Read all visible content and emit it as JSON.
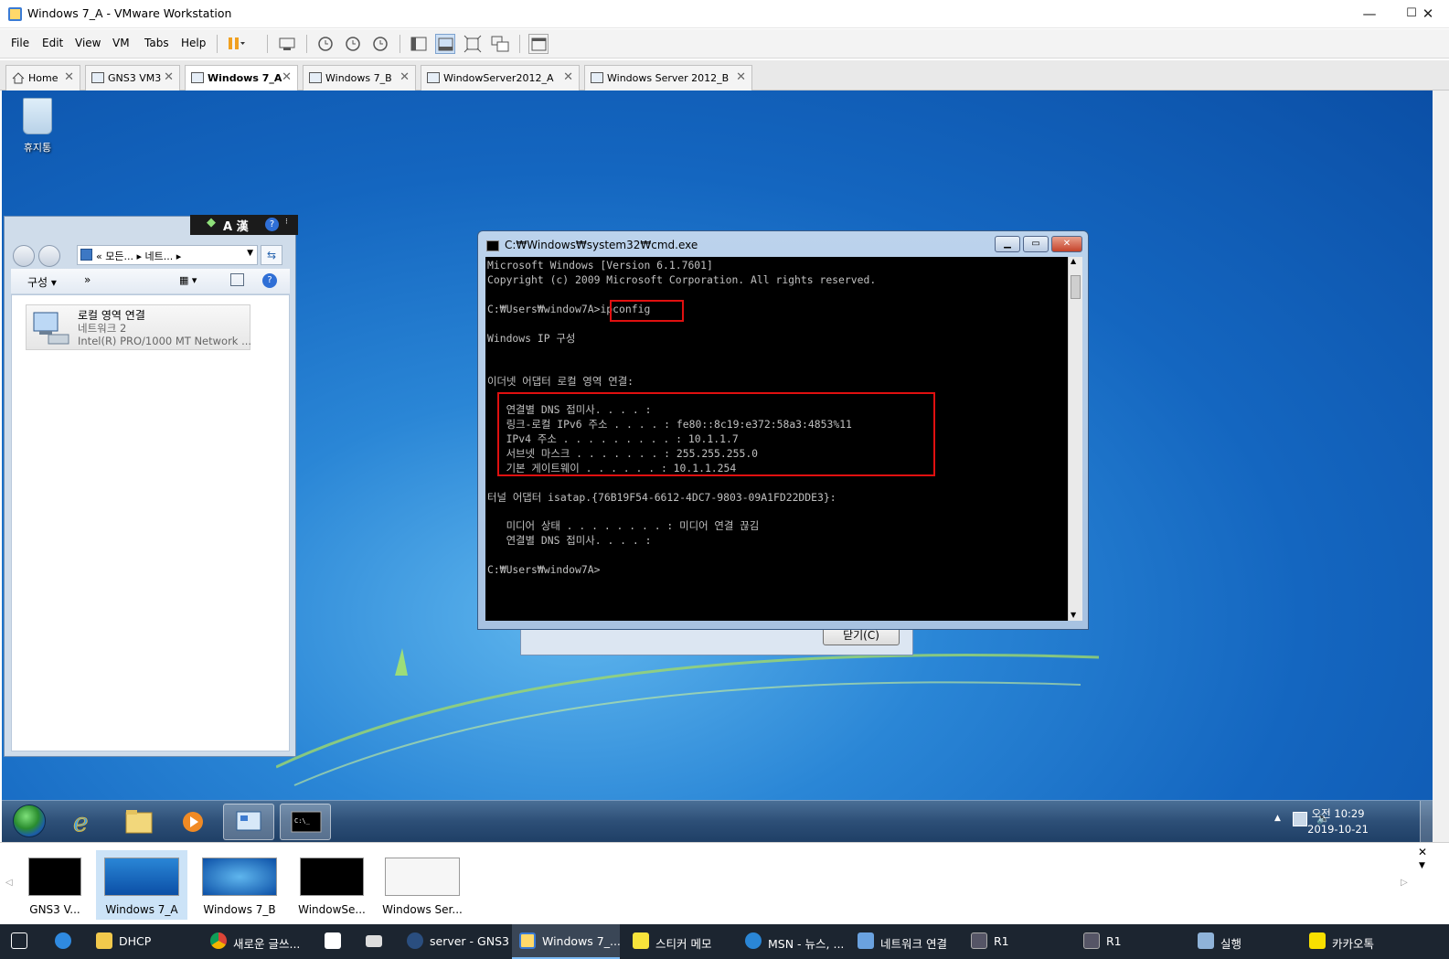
{
  "window": {
    "title": "Windows 7_A - VMware Workstation",
    "minimize": "—",
    "maximize": "☐",
    "close": "✕"
  },
  "menu": [
    "File",
    "Edit",
    "View",
    "VM",
    "Tabs",
    "Help"
  ],
  "tabs": [
    {
      "label": "Home"
    },
    {
      "label": "GNS3 VM3"
    },
    {
      "label": "Windows 7_A",
      "active": true
    },
    {
      "label": "Windows 7_B"
    },
    {
      "label": "WindowServer2012_A"
    },
    {
      "label": "Windows Server 2012_B"
    }
  ],
  "desktop": {
    "recycle_bin": "휴지통"
  },
  "explorer": {
    "ime": "A 漢",
    "address": "« 모든...  ▸ 네트...  ▸",
    "organize": "구성 ▾",
    "more": "»",
    "item": {
      "title": "로컬 영역 연결",
      "line2": "네트워크 2",
      "line3": "Intel(R) PRO/1000 MT Network ..."
    }
  },
  "dialog": {
    "close_button": "닫기(C)"
  },
  "cmd": {
    "title": "C:₩Windows₩system32₩cmd.exe",
    "lines": [
      "Microsoft Windows [Version 6.1.7601]",
      "Copyright (c) 2009 Microsoft Corporation. All rights reserved.",
      "",
      "C:₩Users₩window7A>ipconfig",
      "",
      "Windows IP 구성",
      "",
      "",
      "이더넷 어댑터 로컬 영역 연결:",
      "",
      "   연결별 DNS 접미사. . . . :",
      "   링크-로컬 IPv6 주소 . . . . : fe80::8c19:e372:58a3:4853%11",
      "   IPv4 주소 . . . . . . . . . : 10.1.1.7",
      "   서브넷 마스크 . . . . . . . : 255.255.255.0",
      "   기본 게이트웨이 . . . . . . : 10.1.1.254",
      "",
      "터널 어댑터 isatap.{76B19F54-6612-4DC7-9803-09A1FD22DDE3}:",
      "",
      "   미디어 상태 . . . . . . . . : 미디어 연결 끊김",
      "   연결별 DNS 접미사. . . . :",
      "",
      "C:₩Users₩window7A>"
    ]
  },
  "guest_clock": {
    "time": "오전 10:29",
    "date": "2019-10-21"
  },
  "thumbnails": [
    {
      "label": "GNS3 V..."
    },
    {
      "label": "Windows 7_A",
      "selected": true
    },
    {
      "label": "Windows 7_B"
    },
    {
      "label": "WindowSe..."
    },
    {
      "label": "Windows Ser..."
    }
  ],
  "host_taskbar": [
    {
      "label": "",
      "icon": "task-view-icon"
    },
    {
      "label": "",
      "icon": "edge-icon"
    },
    {
      "label": "DHCP",
      "icon": "folder-icon"
    },
    {
      "label": "새로운 글쓰...",
      "icon": "chrome-icon"
    },
    {
      "label": "",
      "icon": "store-icon"
    },
    {
      "label": "",
      "icon": "mail-icon"
    },
    {
      "label": "server - GNS3",
      "icon": "gns3-icon"
    },
    {
      "label": "Windows 7_...",
      "icon": "vmware-icon",
      "active": true
    },
    {
      "label": "스티커 메모",
      "icon": "sticky-notes-icon"
    },
    {
      "label": "MSN - 뉴스, ...",
      "icon": "ie-icon"
    },
    {
      "label": "네트워크 연결",
      "icon": "network-icon"
    },
    {
      "label": "R1",
      "icon": "terminal-icon"
    },
    {
      "label": "R1",
      "icon": "terminal-icon"
    },
    {
      "label": "실행",
      "icon": "run-icon"
    },
    {
      "label": "카카오톡",
      "icon": "kakaotalk-icon"
    }
  ],
  "colors": {
    "highlight": "#e01010",
    "vmware_tab_accent": "#3a7bd5",
    "desktop": "#1466c0"
  }
}
